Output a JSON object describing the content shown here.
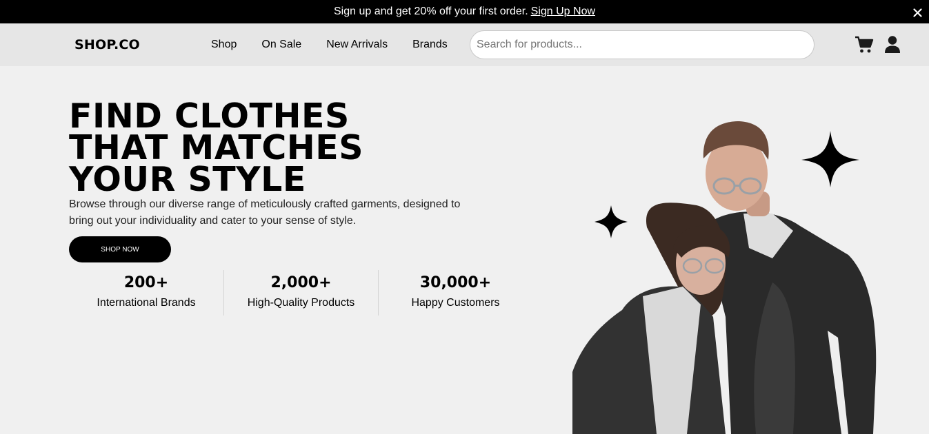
{
  "topbar": {
    "message": "Sign up and get 20% off your first order.",
    "link": "Sign Up Now",
    "close_icon": "close-icon"
  },
  "navbar": {
    "logo": "SHOP.CO",
    "links": [
      "Shop",
      "On Sale",
      "New Arrivals",
      "Brands"
    ],
    "search_placeholder": "Search for products...",
    "icons": [
      "cart-icon",
      "user-icon"
    ]
  },
  "hero": {
    "title_lines": [
      "FIND CLOTHES",
      "THAT MATCHES",
      "YOUR STYLE"
    ],
    "description": "Browse through our diverse range of meticulously crafted garments, designed to bring out your individuality and cater to your sense of style.",
    "cta": "SHOP NOW",
    "stats": [
      {
        "value": "200+",
        "label": "International Brands"
      },
      {
        "value": "2,000+",
        "label": "High-Quality Products"
      },
      {
        "value": "30,000+",
        "label": "Happy Customers"
      }
    ]
  },
  "colors": {
    "topbar_bg": "#000000",
    "navbar_bg": "#e6e6e6",
    "page_bg": "#f0f0f0",
    "button_bg": "#000000"
  }
}
